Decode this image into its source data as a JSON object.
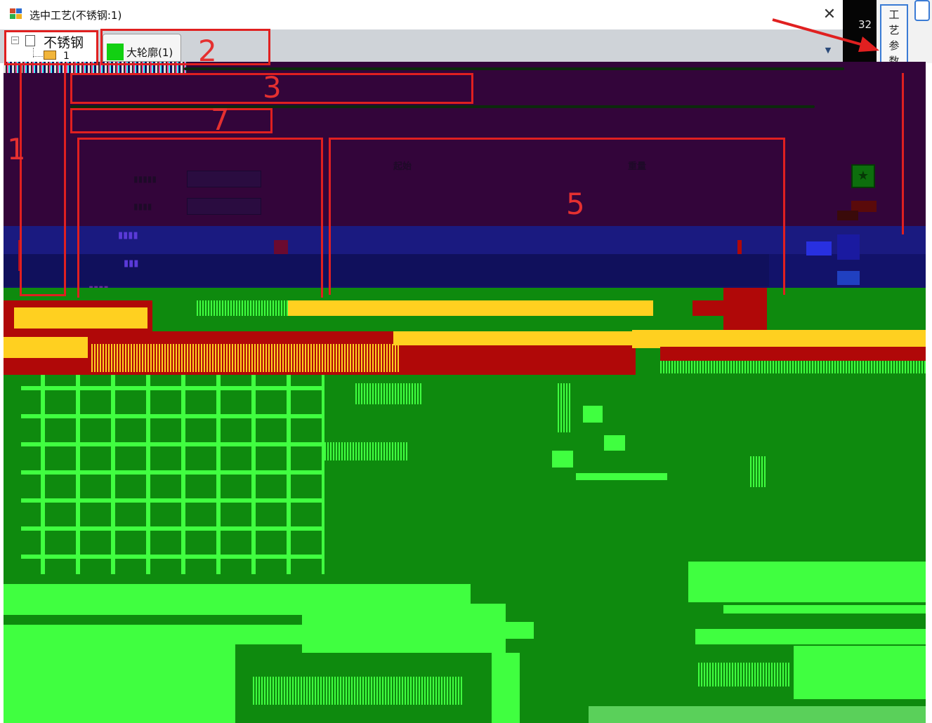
{
  "window": {
    "title": "选中工艺(不锈钢:1)",
    "close_glyph": "✕"
  },
  "tree": {
    "root_label": "不锈钢",
    "child_label": "1",
    "toggle_glyph": "−"
  },
  "tabs": [
    {
      "label": "大轮廓(1)",
      "swatch_color": "#12d012"
    }
  ],
  "right_panel": {
    "number": "32",
    "vertical_button_chars": [
      "工",
      "艺",
      "参",
      "数"
    ]
  },
  "annotations": {
    "labels": [
      "1",
      "2",
      "3",
      "7",
      "5"
    ],
    "color": "#e02020"
  },
  "content": {
    "column_headers": [
      "起始",
      "重量"
    ],
    "star_button_glyph": "★"
  },
  "colors": {
    "purple_panel": "#33053a",
    "blue_band": "#12126a",
    "green_area": "#0e8a0e",
    "bright_green": "#40ff40",
    "yellow": "#ffd020",
    "red": "#b00808"
  }
}
